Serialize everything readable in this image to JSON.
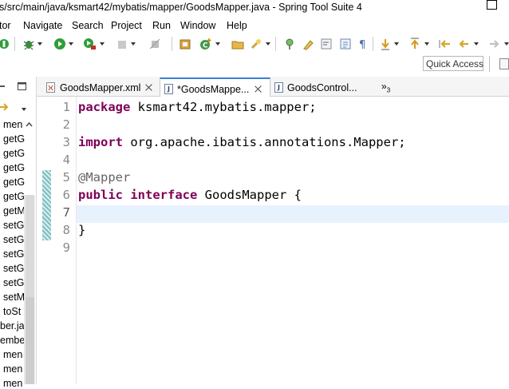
{
  "window": {
    "title": "s/src/main/java/ksmart42/mybatis/mapper/GoodsMapper.java - Spring Tool Suite 4"
  },
  "menu": [
    "tor",
    "Navigate",
    "Search",
    "Project",
    "Run",
    "Window",
    "Help"
  ],
  "quick_access": "Quick Access",
  "left_panel": {
    "items": [
      "men",
      "getG",
      "getG",
      "getG",
      "getG",
      "getG",
      "getM",
      "setG",
      "setG",
      "setG",
      "setG",
      "setG",
      "setM",
      "toSt",
      "ber.ja",
      "embe",
      "men",
      "men",
      "men"
    ]
  },
  "tabs": [
    {
      "label": "GoodsMapper.xml",
      "active": false,
      "closable": true
    },
    {
      "label": "*GoodsMappe...",
      "active": true,
      "closable": true
    },
    {
      "label": "GoodsControl...",
      "active": false,
      "closable": false
    }
  ],
  "tabs_overflow": {
    "symbol": "»",
    "count": "3"
  },
  "editor": {
    "current_line": 7,
    "lines": [
      {
        "n": "1",
        "parts": [
          {
            "t": "package",
            "k": "kw"
          },
          {
            "t": " ksmart42.mybatis.mapper;",
            "k": ""
          }
        ]
      },
      {
        "n": "2",
        "parts": []
      },
      {
        "n": "3",
        "parts": [
          {
            "t": "import",
            "k": "kw"
          },
          {
            "t": " org.apache.ibatis.annotations.Mapper;",
            "k": ""
          }
        ]
      },
      {
        "n": "4",
        "parts": []
      },
      {
        "n": "5",
        "parts": [
          {
            "t": "@Mapper",
            "k": "ann"
          }
        ]
      },
      {
        "n": "6",
        "parts": [
          {
            "t": "public",
            "k": "kw"
          },
          {
            "t": " ",
            "k": ""
          },
          {
            "t": "interface",
            "k": "kw"
          },
          {
            "t": " GoodsMapper {",
            "k": ""
          }
        ]
      },
      {
        "n": "7",
        "parts": []
      },
      {
        "n": "8",
        "parts": [
          {
            "t": "}",
            "k": ""
          }
        ]
      },
      {
        "n": "9",
        "parts": []
      }
    ]
  }
}
